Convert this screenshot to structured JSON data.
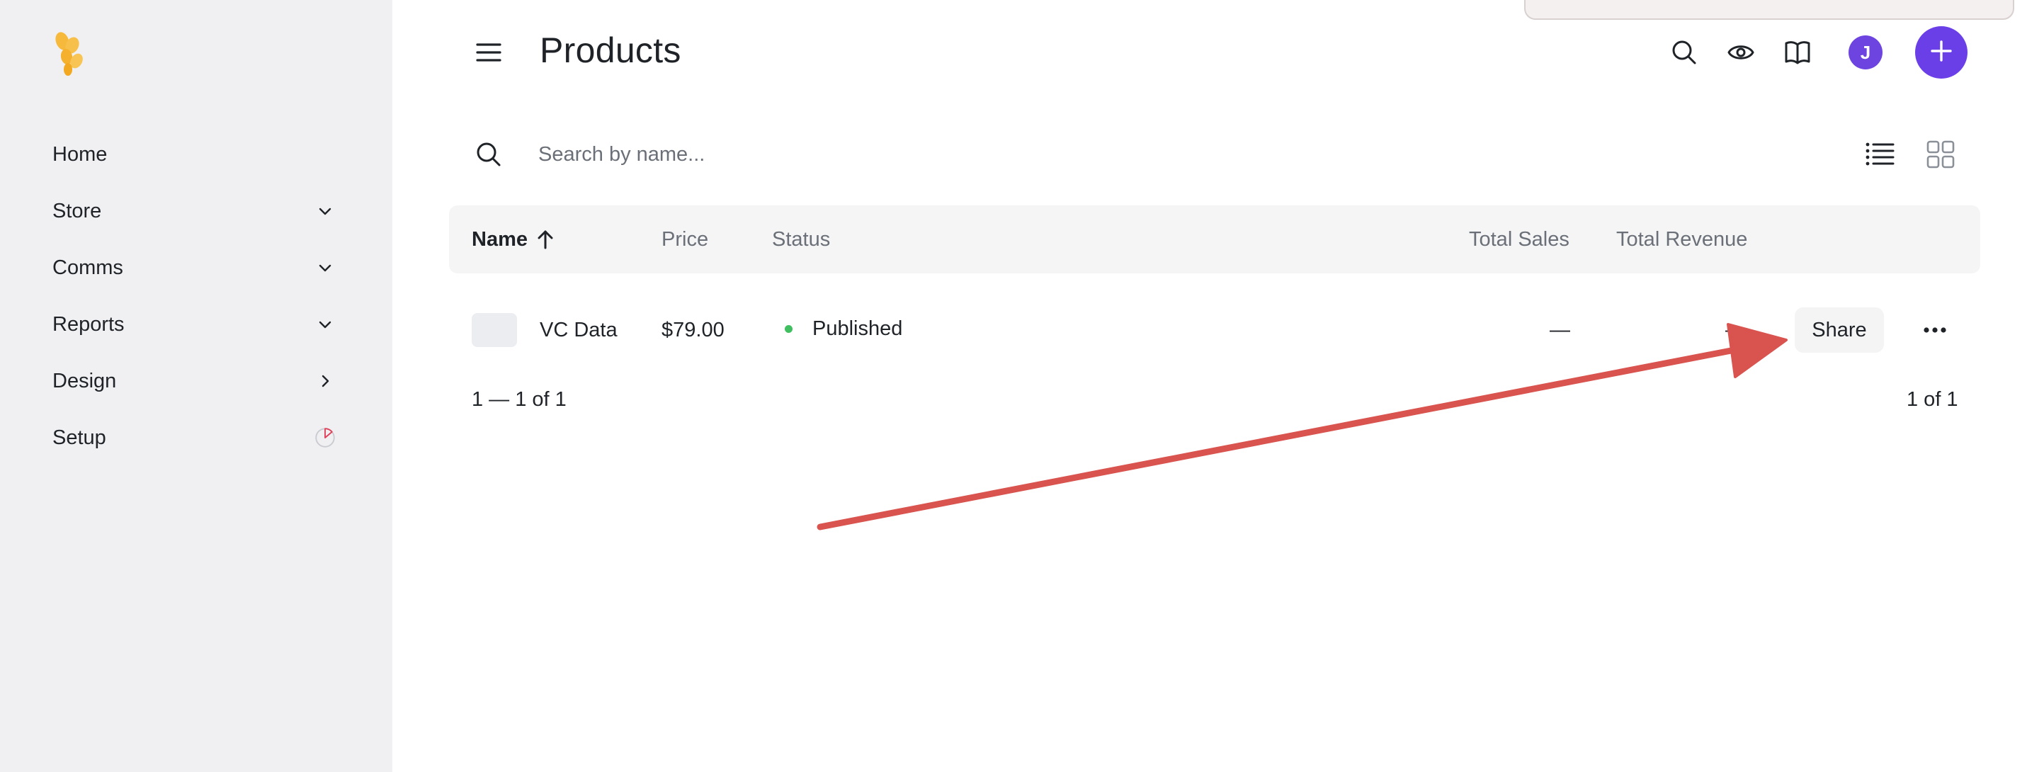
{
  "sidebar": {
    "logo_icon": "lemon-logo-icon",
    "items": [
      {
        "label": "Home",
        "icon": ""
      },
      {
        "label": "Store",
        "icon": "chevron-down-icon"
      },
      {
        "label": "Comms",
        "icon": "chevron-down-icon"
      },
      {
        "label": "Reports",
        "icon": "chevron-down-icon"
      },
      {
        "label": "Design",
        "icon": "chevron-right-icon"
      },
      {
        "label": "Setup",
        "icon": "progress-ring-icon"
      }
    ]
  },
  "header": {
    "title": "Products",
    "avatar_initial": "J",
    "icons": [
      "menu-icon",
      "search-icon",
      "eye-icon",
      "book-icon",
      "plus-icon"
    ]
  },
  "search": {
    "placeholder": "Search by name...",
    "value": ""
  },
  "table": {
    "columns": [
      "Name",
      "Price",
      "Status",
      "Total Sales",
      "Total Revenue"
    ],
    "sort_column": "Name",
    "sort_direction": "ascending",
    "rows": [
      {
        "name": "VC Data",
        "price": "$79.00",
        "status": "Published",
        "total_sales": "—",
        "total_revenue": "—",
        "action": "Share"
      }
    ]
  },
  "pagination": {
    "range": "1 — 1 of 1",
    "pages": "1 of 1"
  },
  "colors": {
    "accent": "#6b3fe8",
    "status_published": "#3fbf5f",
    "annotation_arrow": "#d9534f",
    "sidebar_bg": "#f0f0f2"
  }
}
